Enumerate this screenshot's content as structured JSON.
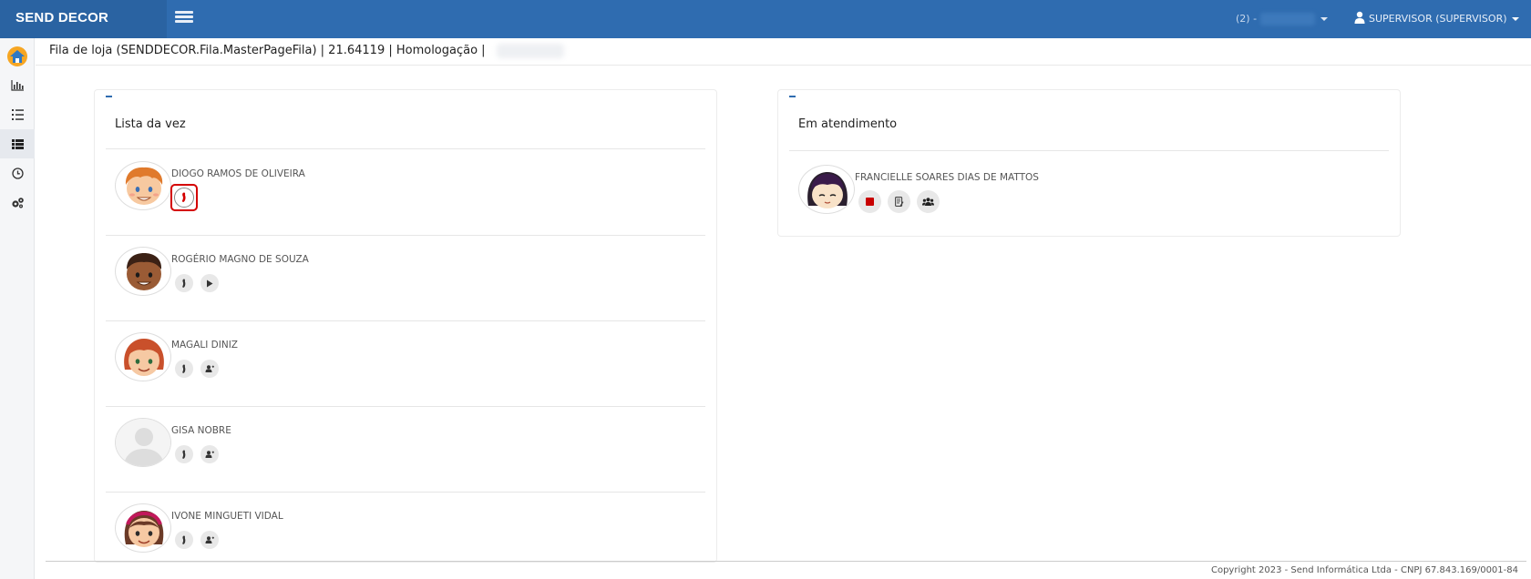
{
  "app": {
    "brand": "SEND DECOR"
  },
  "topbar": {
    "store_selector": "(2) -",
    "user_label": "SUPERVISOR (SUPERVISOR)"
  },
  "page": {
    "title": "Fila de loja (SENDDECOR.Fila.MasterPageFila) | 21.64119 | Homologação |"
  },
  "sidebar": {
    "items": [
      {
        "icon": "home-icon"
      },
      {
        "icon": "bar-chart-icon"
      },
      {
        "icon": "list-ordered-icon"
      },
      {
        "icon": "list-icon",
        "active": true
      },
      {
        "icon": "clock-icon"
      },
      {
        "icon": "gears-icon"
      }
    ]
  },
  "queue": {
    "title": "Lista da vez",
    "entries": [
      {
        "name": "DIOGO RAMOS DE OLIVEIRA",
        "avatar": "boy-orange-hair",
        "actions": [
          "walk-icon"
        ]
      },
      {
        "name": "ROGÉRIO MAGNO DE SOUZA",
        "avatar": "boy-dark-skin",
        "actions": [
          "walk-icon",
          "play-icon"
        ]
      },
      {
        "name": "MAGALI DINIZ",
        "avatar": "girl-red-hair",
        "actions": [
          "walk-icon",
          "user-plus-icon"
        ]
      },
      {
        "name": "GISA NOBRE",
        "avatar": "placeholder",
        "actions": [
          "walk-icon",
          "user-plus-icon"
        ]
      },
      {
        "name": "IVONE MINGUETI VIDAL",
        "avatar": "girl-headband",
        "actions": [
          "walk-icon",
          "user-plus-icon"
        ]
      }
    ]
  },
  "attending": {
    "title": "Em atendimento",
    "entries": [
      {
        "name": "FRANCIELLE SOARES DIAS DE MATTOS",
        "avatar": "girl-dark-hair",
        "actions": [
          "stop-icon",
          "notes-icon",
          "group-icon"
        ]
      }
    ]
  },
  "footer": {
    "copyright": "Copyright 2023 - Send Informática Ltda - CNPJ 67.843.169/0001-84"
  },
  "colors": {
    "primary": "#2f6cb0",
    "brand_bg": "#2a63a2",
    "highlight": "#d40000",
    "stop": "#c80000"
  }
}
